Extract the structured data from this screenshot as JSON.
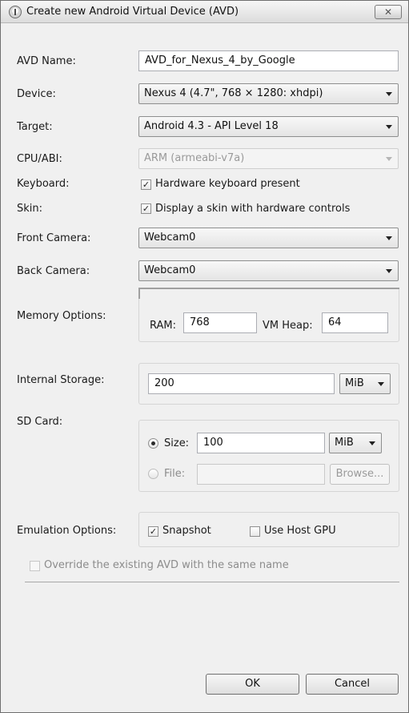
{
  "window": {
    "title": "Create new Android Virtual Device (AVD)",
    "close_label": "✕"
  },
  "form": {
    "avd_name": {
      "label": "AVD Name:",
      "value": "AVD_for_Nexus_4_by_Google"
    },
    "device": {
      "label": "Device:",
      "value": "Nexus 4 (4.7\", 768 × 1280: xhdpi)"
    },
    "target": {
      "label": "Target:",
      "value": "Android 4.3 - API Level 18"
    },
    "cpu_abi": {
      "label": "CPU/ABI:",
      "value": "ARM (armeabi-v7a)",
      "enabled": false
    },
    "keyboard": {
      "label": "Keyboard:",
      "checkbox_label": "Hardware keyboard present",
      "checked": true
    },
    "skin": {
      "label": "Skin:",
      "checkbox_label": "Display a skin with hardware controls",
      "checked": true
    },
    "front_camera": {
      "label": "Front Camera:",
      "value": "Webcam0"
    },
    "back_camera": {
      "label": "Back Camera:",
      "value": "Webcam0"
    },
    "memory": {
      "label": "Memory Options:",
      "ram_label": "RAM:",
      "ram_value": "768",
      "vm_heap_label": "VM Heap:",
      "vm_heap_value": "64"
    },
    "internal_storage": {
      "label": "Internal Storage:",
      "value": "200",
      "unit": "MiB"
    },
    "sd_card": {
      "label": "SD Card:",
      "size_label": "Size:",
      "size_value": "100",
      "size_unit": "MiB",
      "size_selected": true,
      "file_label": "File:",
      "file_value": "",
      "browse_label": "Browse..."
    },
    "emulation": {
      "label": "Emulation Options:",
      "snapshot_label": "Snapshot",
      "snapshot_checked": true,
      "host_gpu_label": "Use Host GPU",
      "host_gpu_checked": false
    },
    "override": {
      "label": "Override the existing AVD with the same name",
      "checked": false,
      "enabled": false
    }
  },
  "buttons": {
    "ok": "OK",
    "cancel": "Cancel"
  },
  "marks": {
    "check": "✓"
  }
}
